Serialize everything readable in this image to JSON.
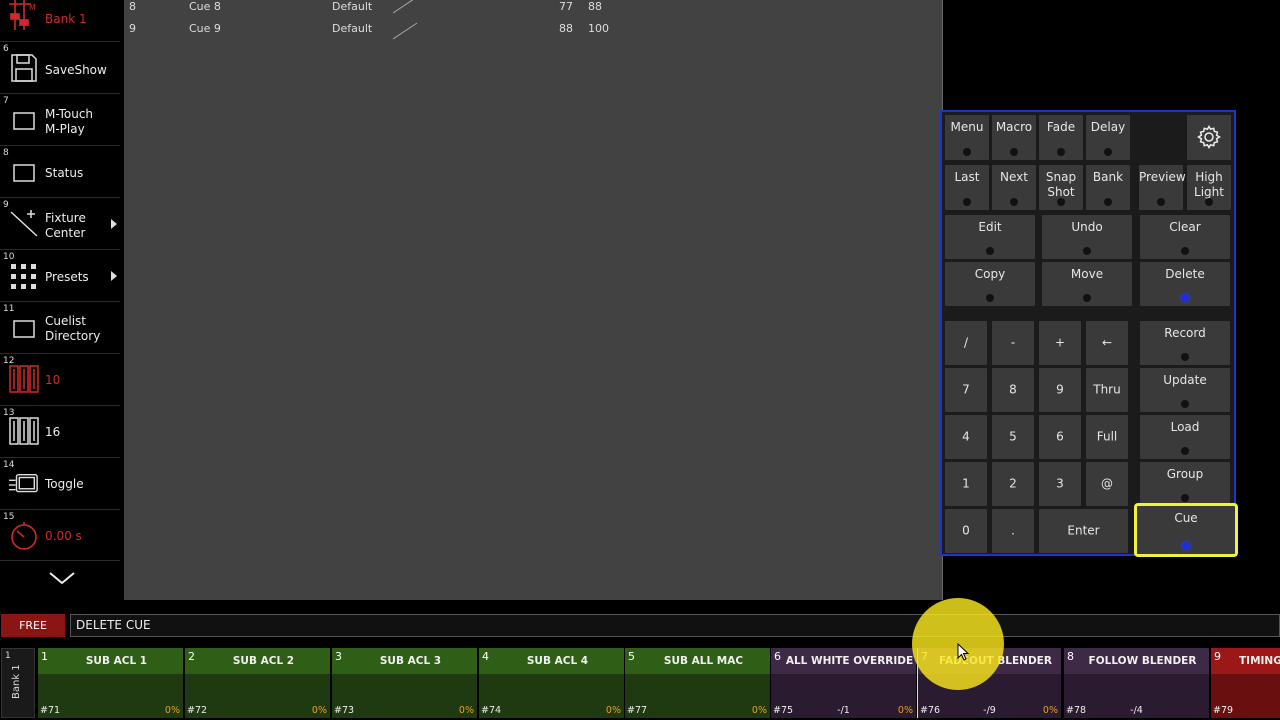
{
  "sidebar": {
    "items": [
      {
        "num": "",
        "label": "Bank 1",
        "icon": "master-fader-icon",
        "red": true
      },
      {
        "num": "6",
        "label": "SaveShow",
        "icon": "floppy-disk-icon"
      },
      {
        "num": "7",
        "label": "M-Touch\nM-Play",
        "icon": "window-icon"
      },
      {
        "num": "8",
        "label": "Status",
        "icon": "window-icon"
      },
      {
        "num": "9",
        "label": "Fixture\nCenter",
        "icon": "fixture-wand-icon",
        "arrow": true
      },
      {
        "num": "10",
        "label": "Presets",
        "icon": "grid-dots-icon",
        "arrow": true
      },
      {
        "num": "11",
        "label": "Cuelist\nDirectory",
        "icon": "window-icon"
      },
      {
        "num": "12",
        "label": "10",
        "icon": "faders-icon",
        "red": true
      },
      {
        "num": "13",
        "label": "16",
        "icon": "faders-icon"
      },
      {
        "num": "14",
        "label": "Toggle",
        "icon": "toggle-icon"
      },
      {
        "num": "15",
        "label": "0.00 s",
        "icon": "timer-icon",
        "red": true
      }
    ],
    "scroll_down": "chevron-down-icon"
  },
  "cuelist": {
    "rows": [
      {
        "num": "8",
        "name": "Cue 8",
        "template": "Default",
        "a": "77",
        "b": "88"
      },
      {
        "num": "9",
        "name": "Cue 9",
        "template": "Default",
        "a": "88",
        "b": "100"
      }
    ]
  },
  "keypad": {
    "row1": [
      "Menu",
      "Macro",
      "Fade",
      "Delay"
    ],
    "row2": [
      "Last",
      "Next",
      "Snap\nShot",
      "Bank",
      "Preview",
      "High\nLight"
    ],
    "row3": [
      "Edit",
      "Undo",
      "Clear"
    ],
    "row4": [
      "Copy",
      "Move",
      "Delete"
    ],
    "numpad": [
      [
        "/",
        "-",
        "+",
        "←"
      ],
      [
        "7",
        "8",
        "9",
        "Thru"
      ],
      [
        "4",
        "5",
        "6",
        "Full"
      ],
      [
        "1",
        "2",
        "3",
        "@"
      ]
    ],
    "bottom": [
      "0",
      ".",
      "Enter"
    ],
    "right_col": [
      "Record",
      "Update",
      "Load",
      "Group",
      "Cue"
    ],
    "settings_icon": "gear-icon",
    "accent": "#1a35c8",
    "highlight": "#f2f23a"
  },
  "command": {
    "mode": "FREE",
    "text": "DELETE CUE"
  },
  "bank": {
    "num": "1",
    "label": "Bank 1",
    "faders": [
      {
        "num": "1",
        "name": "SUB ACL 1",
        "id": "#71",
        "mid": "",
        "pct": "0%",
        "color": "green"
      },
      {
        "num": "2",
        "name": "SUB ACL 2",
        "id": "#72",
        "mid": "",
        "pct": "0%",
        "color": "green"
      },
      {
        "num": "3",
        "name": "SUB ACL 3",
        "id": "#73",
        "mid": "",
        "pct": "0%",
        "color": "green"
      },
      {
        "num": "4",
        "name": "SUB ACL 4",
        "id": "#74",
        "mid": "",
        "pct": "0%",
        "color": "green"
      },
      {
        "num": "5",
        "name": "SUB ALL MAC",
        "id": "#77",
        "mid": "",
        "pct": "0%",
        "color": "green"
      },
      {
        "num": "6",
        "name": "ALL WHITE OVERRIDE",
        "id": "#75",
        "mid": "-/1",
        "pct": "0%",
        "color": "purple"
      },
      {
        "num": "7",
        "name": "FADEOUT BLENDER",
        "id": "#76",
        "mid": "-/9",
        "pct": "0%",
        "color": "purple"
      },
      {
        "num": "8",
        "name": "FOLLOW BLENDER",
        "id": "#78",
        "mid": "-/4",
        "pct": "",
        "color": "purple"
      },
      {
        "num": "9",
        "name": "TIMING",
        "id": "#79",
        "mid": "",
        "pct": "",
        "color": "red"
      }
    ]
  }
}
